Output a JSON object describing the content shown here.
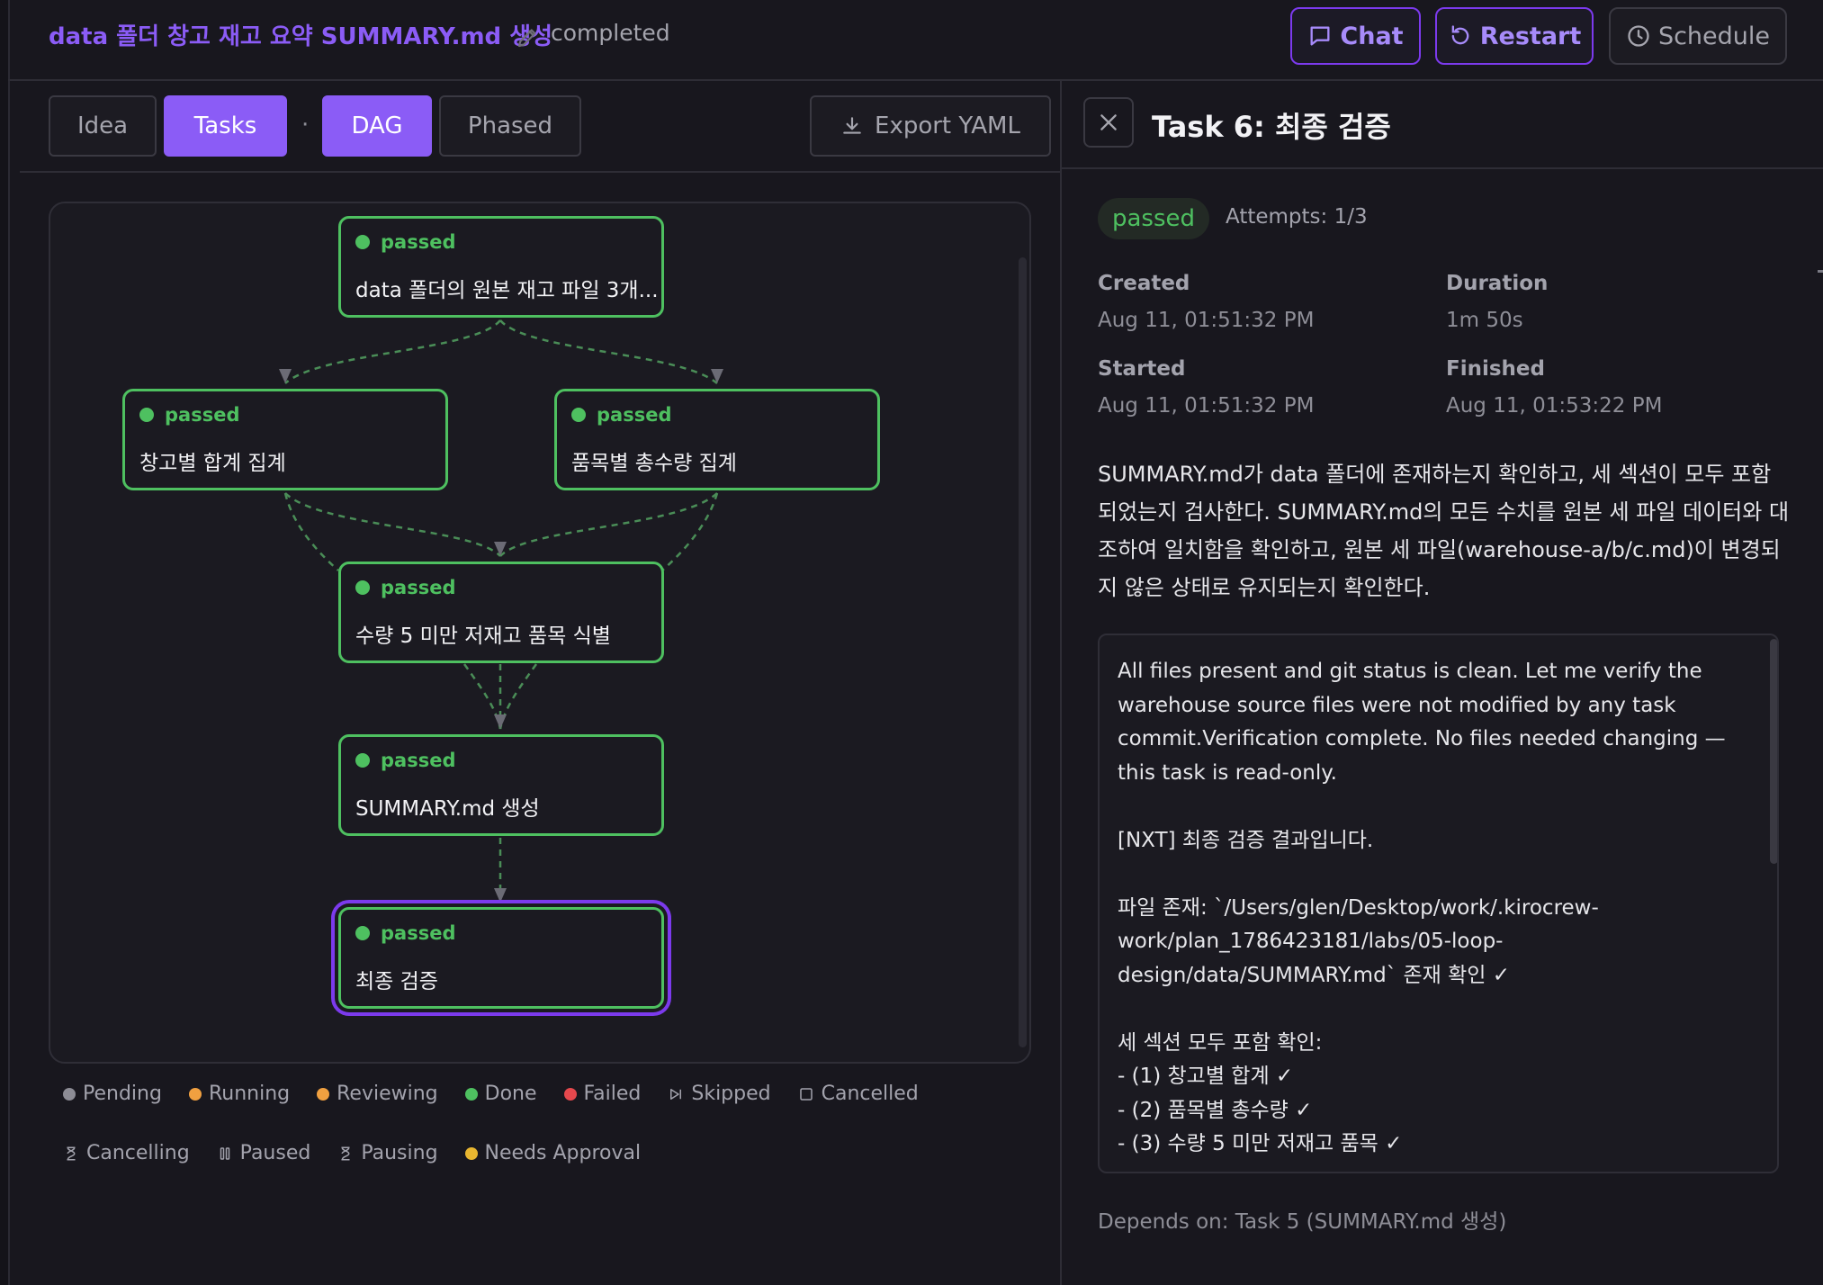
{
  "header": {
    "title": "data 폴더 창고 재고 요약 SUMMARY.md 생성",
    "status": "completed",
    "chat_label": "Chat",
    "restart_label": "Restart",
    "schedule_label": "Schedule"
  },
  "tabs": {
    "idea": "Idea",
    "tasks": "Tasks",
    "separator": "·",
    "dag": "DAG",
    "phased": "Phased",
    "export": "Export YAML"
  },
  "dag": {
    "nodes": [
      {
        "status": "passed",
        "label": "data 폴더의 원본 재고 파일 3개..."
      },
      {
        "status": "passed",
        "label": "창고별 합계 집계"
      },
      {
        "status": "passed",
        "label": "품목별 총수량 집계"
      },
      {
        "status": "passed",
        "label": "수량 5 미만 저재고 품목 식별"
      },
      {
        "status": "passed",
        "label": "SUMMARY.md 생성"
      },
      {
        "status": "passed",
        "label": "최종 검증"
      }
    ]
  },
  "legend": {
    "items": [
      "Pending",
      "Running",
      "Reviewing",
      "Done",
      "Failed",
      "Skipped",
      "Cancelled",
      "Cancelling",
      "Paused",
      "Pausing",
      "Needs Approval"
    ],
    "colors": {
      "pending": "#8c8c95",
      "running": "#f0a040",
      "reviewing": "#f0a040",
      "done": "#4ec060",
      "failed": "#e5484d",
      "needs_approval": "#e8b630"
    }
  },
  "task": {
    "title": "Task 6: 최종 검증",
    "badge": "passed",
    "attempts": "Attempts: 1/3",
    "created_label": "Created",
    "created": "Aug 11, 01:51:32 PM",
    "duration_label": "Duration",
    "duration": "1m 50s",
    "started_label": "Started",
    "started": "Aug 11, 01:51:32 PM",
    "finished_label": "Finished",
    "finished": "Aug 11, 01:53:22 PM",
    "description": "SUMMARY.md가 data 폴더에 존재하는지 확인하고, 세 섹션이 모두 포함되었는지 검사한다. SUMMARY.md의 모든 수치를 원본 세 파일 데이터와 대조하여 일치함을 확인하고, 원본 세 파일(warehouse-a/b/c.md)이 변경되지 않은 상태로 유지되는지 확인한다.",
    "log": "All files present and git status is clean. Let me verify the warehouse source files were not modified by any task commit.Verification complete. No files needed changing — this task is read-only.\n\n[NXT] 최종 검증 결과입니다.\n\n파일 존재: `/Users/glen/Desktop/work/.kirocrew-work/plan_1786423181/labs/05-loop-design/data/SUMMARY.md` 존재 확인 ✓\n\n세 섹션 모두 포함 확인:\n- (1) 창고별 합계 ✓\n- (2) 품목별 총수량 ✓\n- (3) 수량 5 미만 저재고 품목 ✓",
    "depends": "Depends on: Task 5 (SUMMARY.md 생성)"
  },
  "colors": {
    "accent": "#8b5cf6",
    "passed": "#4ec060",
    "background": "#18171e"
  }
}
